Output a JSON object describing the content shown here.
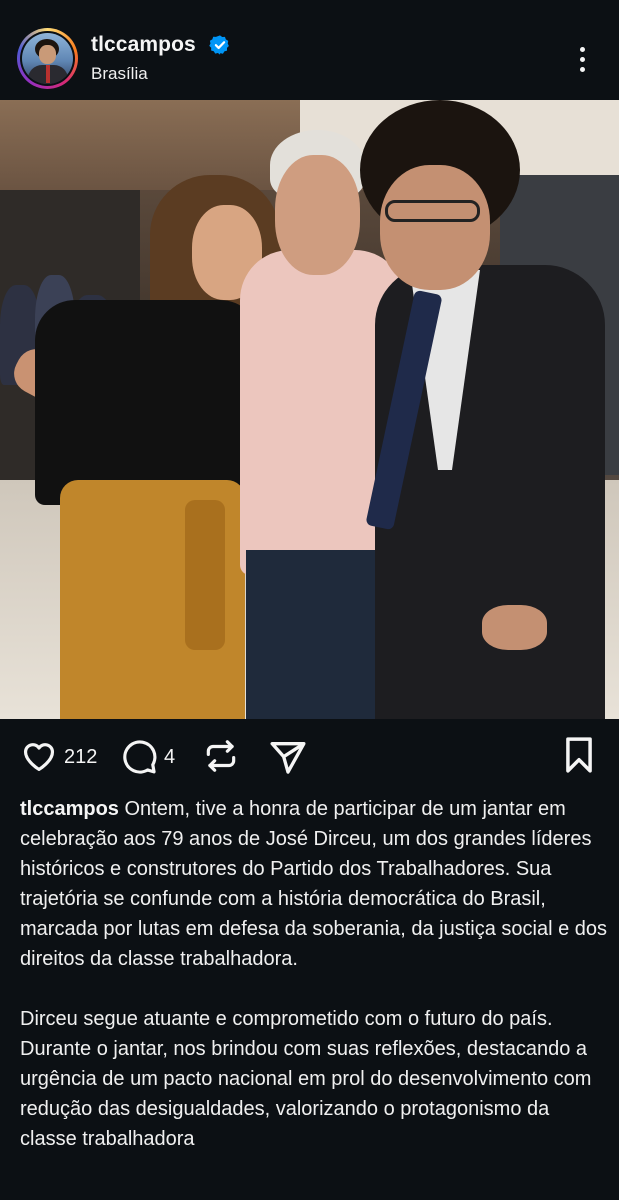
{
  "post": {
    "username": "tlccampos",
    "verified": true,
    "location": "Brasília"
  },
  "actions": {
    "like_count": "212",
    "comment_count": "4"
  },
  "caption": {
    "username": "tlccampos",
    "paragraph1": "Ontem, tive a honra de participar de um jantar em celebração aos 79 anos de José Dirceu, um dos grandes líderes históricos e construtores do Partido dos Trabalhadores. Sua trajetória se confunde com a história democrática do Brasil, marcada por lutas em defesa da soberania, da justiça social e dos direitos da classe trabalhadora.",
    "paragraph2": "Dirceu segue atuante e comprometido com o futuro do país. Durante o jantar, nos brindou com suas reflexões, destacando a urgência de um pacto nacional em prol do desenvolvimento com redução das desigualdades, valorizando o protagonismo da classe trabalhadora"
  },
  "colors": {
    "background": "#0c1014",
    "text": "#f5f5f5",
    "verified_badge": "#0095f6"
  },
  "icons": {
    "avatar": "profile-photo",
    "verified": "verified-badge-icon",
    "more": "more-options-icon",
    "like": "heart-icon",
    "comment": "comment-bubble-icon",
    "repost": "repost-icon",
    "share": "share-paper-plane-icon",
    "save": "bookmark-icon"
  }
}
